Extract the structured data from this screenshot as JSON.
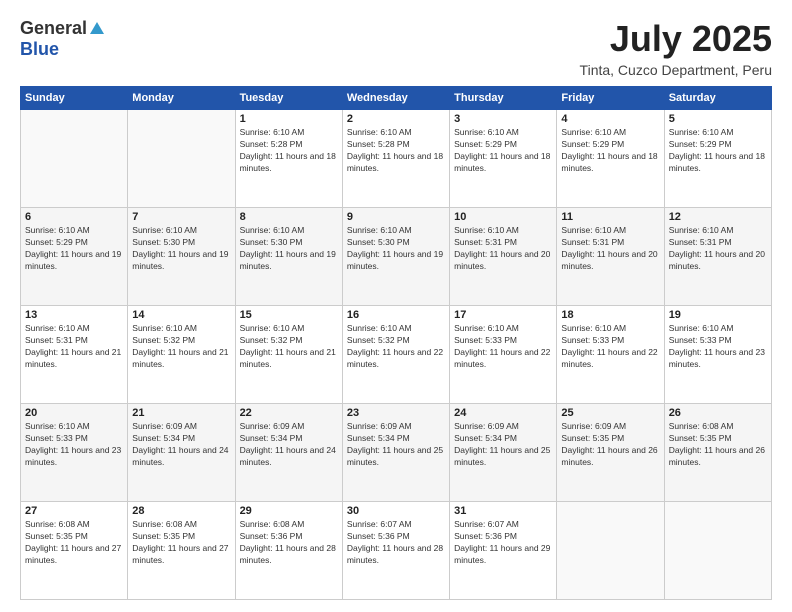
{
  "logo": {
    "general": "General",
    "blue": "Blue"
  },
  "title": "July 2025",
  "location": "Tinta, Cuzco Department, Peru",
  "days_of_week": [
    "Sunday",
    "Monday",
    "Tuesday",
    "Wednesday",
    "Thursday",
    "Friday",
    "Saturday"
  ],
  "weeks": [
    [
      {
        "day": "",
        "details": ""
      },
      {
        "day": "",
        "details": ""
      },
      {
        "day": "1",
        "details": "Sunrise: 6:10 AM\nSunset: 5:28 PM\nDaylight: 11 hours and 18 minutes."
      },
      {
        "day": "2",
        "details": "Sunrise: 6:10 AM\nSunset: 5:28 PM\nDaylight: 11 hours and 18 minutes."
      },
      {
        "day": "3",
        "details": "Sunrise: 6:10 AM\nSunset: 5:29 PM\nDaylight: 11 hours and 18 minutes."
      },
      {
        "day": "4",
        "details": "Sunrise: 6:10 AM\nSunset: 5:29 PM\nDaylight: 11 hours and 18 minutes."
      },
      {
        "day": "5",
        "details": "Sunrise: 6:10 AM\nSunset: 5:29 PM\nDaylight: 11 hours and 18 minutes."
      }
    ],
    [
      {
        "day": "6",
        "details": "Sunrise: 6:10 AM\nSunset: 5:29 PM\nDaylight: 11 hours and 19 minutes."
      },
      {
        "day": "7",
        "details": "Sunrise: 6:10 AM\nSunset: 5:30 PM\nDaylight: 11 hours and 19 minutes."
      },
      {
        "day": "8",
        "details": "Sunrise: 6:10 AM\nSunset: 5:30 PM\nDaylight: 11 hours and 19 minutes."
      },
      {
        "day": "9",
        "details": "Sunrise: 6:10 AM\nSunset: 5:30 PM\nDaylight: 11 hours and 19 minutes."
      },
      {
        "day": "10",
        "details": "Sunrise: 6:10 AM\nSunset: 5:31 PM\nDaylight: 11 hours and 20 minutes."
      },
      {
        "day": "11",
        "details": "Sunrise: 6:10 AM\nSunset: 5:31 PM\nDaylight: 11 hours and 20 minutes."
      },
      {
        "day": "12",
        "details": "Sunrise: 6:10 AM\nSunset: 5:31 PM\nDaylight: 11 hours and 20 minutes."
      }
    ],
    [
      {
        "day": "13",
        "details": "Sunrise: 6:10 AM\nSunset: 5:31 PM\nDaylight: 11 hours and 21 minutes."
      },
      {
        "day": "14",
        "details": "Sunrise: 6:10 AM\nSunset: 5:32 PM\nDaylight: 11 hours and 21 minutes."
      },
      {
        "day": "15",
        "details": "Sunrise: 6:10 AM\nSunset: 5:32 PM\nDaylight: 11 hours and 21 minutes."
      },
      {
        "day": "16",
        "details": "Sunrise: 6:10 AM\nSunset: 5:32 PM\nDaylight: 11 hours and 22 minutes."
      },
      {
        "day": "17",
        "details": "Sunrise: 6:10 AM\nSunset: 5:33 PM\nDaylight: 11 hours and 22 minutes."
      },
      {
        "day": "18",
        "details": "Sunrise: 6:10 AM\nSunset: 5:33 PM\nDaylight: 11 hours and 22 minutes."
      },
      {
        "day": "19",
        "details": "Sunrise: 6:10 AM\nSunset: 5:33 PM\nDaylight: 11 hours and 23 minutes."
      }
    ],
    [
      {
        "day": "20",
        "details": "Sunrise: 6:10 AM\nSunset: 5:33 PM\nDaylight: 11 hours and 23 minutes."
      },
      {
        "day": "21",
        "details": "Sunrise: 6:09 AM\nSunset: 5:34 PM\nDaylight: 11 hours and 24 minutes."
      },
      {
        "day": "22",
        "details": "Sunrise: 6:09 AM\nSunset: 5:34 PM\nDaylight: 11 hours and 24 minutes."
      },
      {
        "day": "23",
        "details": "Sunrise: 6:09 AM\nSunset: 5:34 PM\nDaylight: 11 hours and 25 minutes."
      },
      {
        "day": "24",
        "details": "Sunrise: 6:09 AM\nSunset: 5:34 PM\nDaylight: 11 hours and 25 minutes."
      },
      {
        "day": "25",
        "details": "Sunrise: 6:09 AM\nSunset: 5:35 PM\nDaylight: 11 hours and 26 minutes."
      },
      {
        "day": "26",
        "details": "Sunrise: 6:08 AM\nSunset: 5:35 PM\nDaylight: 11 hours and 26 minutes."
      }
    ],
    [
      {
        "day": "27",
        "details": "Sunrise: 6:08 AM\nSunset: 5:35 PM\nDaylight: 11 hours and 27 minutes."
      },
      {
        "day": "28",
        "details": "Sunrise: 6:08 AM\nSunset: 5:35 PM\nDaylight: 11 hours and 27 minutes."
      },
      {
        "day": "29",
        "details": "Sunrise: 6:08 AM\nSunset: 5:36 PM\nDaylight: 11 hours and 28 minutes."
      },
      {
        "day": "30",
        "details": "Sunrise: 6:07 AM\nSunset: 5:36 PM\nDaylight: 11 hours and 28 minutes."
      },
      {
        "day": "31",
        "details": "Sunrise: 6:07 AM\nSunset: 5:36 PM\nDaylight: 11 hours and 29 minutes."
      },
      {
        "day": "",
        "details": ""
      },
      {
        "day": "",
        "details": ""
      }
    ]
  ]
}
